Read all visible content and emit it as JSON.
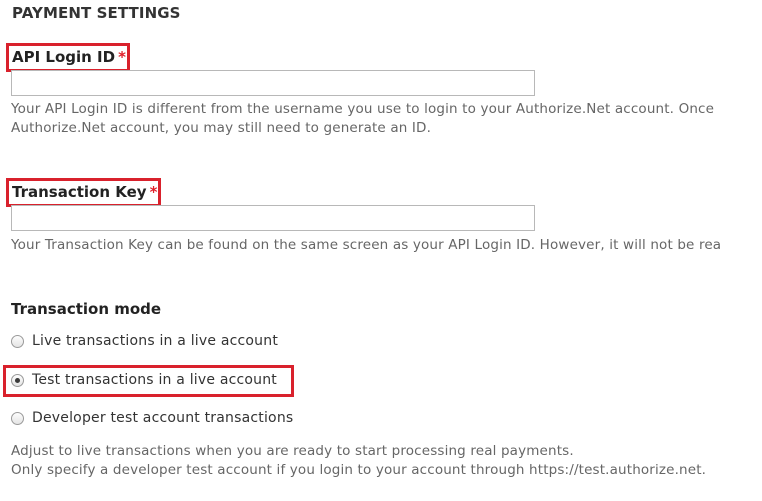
{
  "section": {
    "title": "PAYMENT SETTINGS"
  },
  "api_login": {
    "label": "API Login ID",
    "required_marker": "*",
    "value": "",
    "description_line1": "Your API Login ID is different from the username you use to login to your Authorize.Net account. Once",
    "description_line2": "Authorize.Net account, you may still need to generate an ID."
  },
  "transaction_key": {
    "label": "Transaction Key",
    "required_marker": "*",
    "value": "",
    "description": "Your Transaction Key can be found on the same screen as your API Login ID. However, it will not be rea"
  },
  "transaction_mode": {
    "heading": "Transaction mode",
    "options": [
      {
        "label": "Live transactions in a live account",
        "selected": false
      },
      {
        "label": "Test transactions in a live account",
        "selected": true
      },
      {
        "label": "Developer test account transactions",
        "selected": false
      }
    ],
    "help_line1": "Adjust to live transactions when you are ready to start processing real payments.",
    "help_line2": "Only specify a developer test account if you login to your account through https://test.authorize.net."
  },
  "colors": {
    "highlight_border": "#d9212c",
    "required_star": "#e0202a",
    "description_text": "#666666"
  }
}
